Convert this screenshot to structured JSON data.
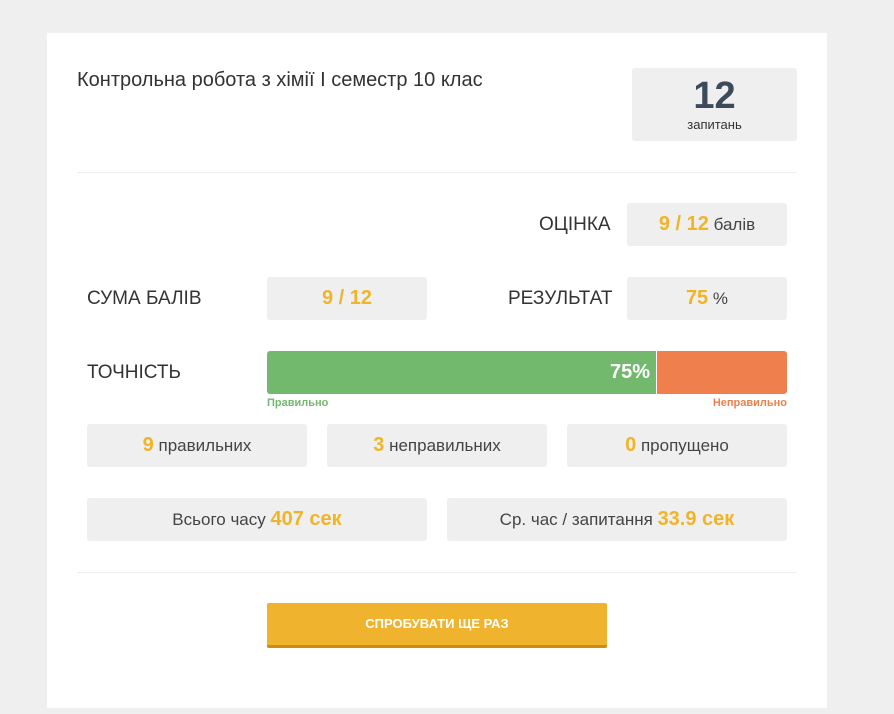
{
  "quiz": {
    "title": "Контрольна робота з хімії І семестр 10 клас",
    "questions_count": "12",
    "questions_label": "запитань"
  },
  "grade": {
    "label": "ОЦІНКА",
    "value": "9 / 12",
    "unit": "балів"
  },
  "score_sum": {
    "label": "СУМА БАЛІВ",
    "value": "9 / 12"
  },
  "result": {
    "label": "РЕЗУЛЬТАТ",
    "value": "75",
    "unit": "%"
  },
  "accuracy": {
    "label": "ТОЧНІСТЬ",
    "correct_fraction": 0.75,
    "percent_text": "75%",
    "correct_label": "Правильно",
    "incorrect_label": "Неправильно",
    "correct_color": "#72b96e",
    "incorrect_color": "#ef7f4d"
  },
  "counts": {
    "correct_value": "9",
    "correct_label": "правильних",
    "incorrect_value": "3",
    "incorrect_label": "неправильних",
    "skipped_value": "0",
    "skipped_label": "пропущено"
  },
  "time": {
    "total_label": "Всього часу",
    "total_value": "407 сек",
    "avg_label": "Ср. час / запитання",
    "avg_value": "33.9 сек"
  },
  "retry_button": {
    "label": "СПРОБУВАТИ ЩЕ РАЗ"
  },
  "colors": {
    "accent": "#f0b429",
    "button": "#f0b32e"
  }
}
